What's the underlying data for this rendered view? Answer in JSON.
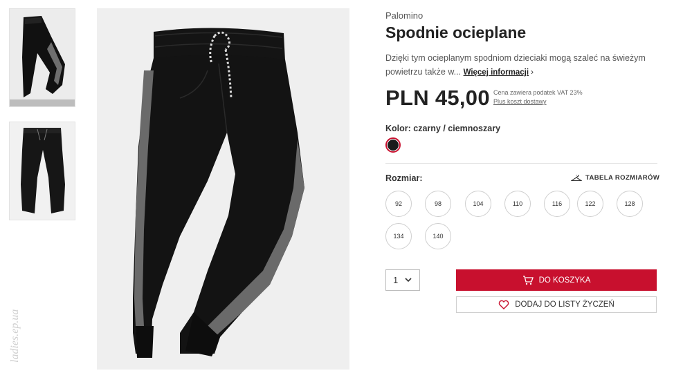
{
  "product": {
    "brand": "Palomino",
    "title": "Spodnie ocieplane",
    "description": "Dzięki tym ocieplanym spodniom dzieciaki mogą szaleć na świeżym powietrzu także w...",
    "more_link": "Więcej informacji",
    "price": "PLN 45,00",
    "vat_note": "Cena zawiera podatek VAT 23%",
    "shipping_note": "Plus koszt dostawy"
  },
  "color": {
    "label": "Kolor: czarny / ciemnoszary",
    "swatch_color": "#1b1b1b",
    "selected_border": "#c8102e"
  },
  "sizes": {
    "label": "Rozmiar:",
    "chart_link": "TABELA ROZMIARÓW",
    "options": [
      "92",
      "98",
      "104",
      "110",
      "116",
      "122",
      "128",
      "134",
      "140"
    ]
  },
  "purchase": {
    "quantity": "1",
    "add_to_cart": "DO KOSZYKA",
    "add_to_wishlist": "DODAJ DO LISTY ŻYCZEŃ",
    "accent_color": "#c8102e"
  },
  "icons": [
    "chevron-right-icon",
    "hanger-icon",
    "cart-icon",
    "heart-icon",
    "chevron-down-icon"
  ],
  "watermark": "ladies.ep.ua"
}
